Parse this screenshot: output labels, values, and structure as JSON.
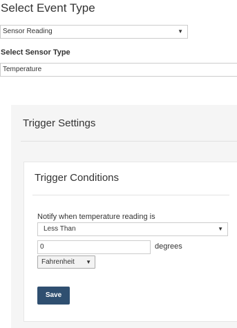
{
  "event_type": {
    "label": "Select Event Type",
    "selected": "Sensor Reading",
    "arrow": "▼"
  },
  "sensor_type": {
    "label": "Select Sensor Type",
    "value": "Temperature"
  },
  "trigger_settings": {
    "title": "Trigger Settings"
  },
  "trigger_conditions": {
    "title": "Trigger Conditions",
    "notify_label": "Notify when temperature reading is",
    "operator_selected": "Less Than",
    "operator_arrow": "▼",
    "threshold_value": "0",
    "degrees_label": "degrees",
    "unit_selected": "Fahrenheit",
    "unit_arrow": "▼"
  },
  "actions": {
    "save_label": "Save"
  },
  "colors": {
    "save_button_bg": "#2f4f70",
    "panel_bg": "#f5f5f5",
    "border": "#cccccc"
  },
  "icons": {
    "dropdown": "chevron-down-icon"
  }
}
